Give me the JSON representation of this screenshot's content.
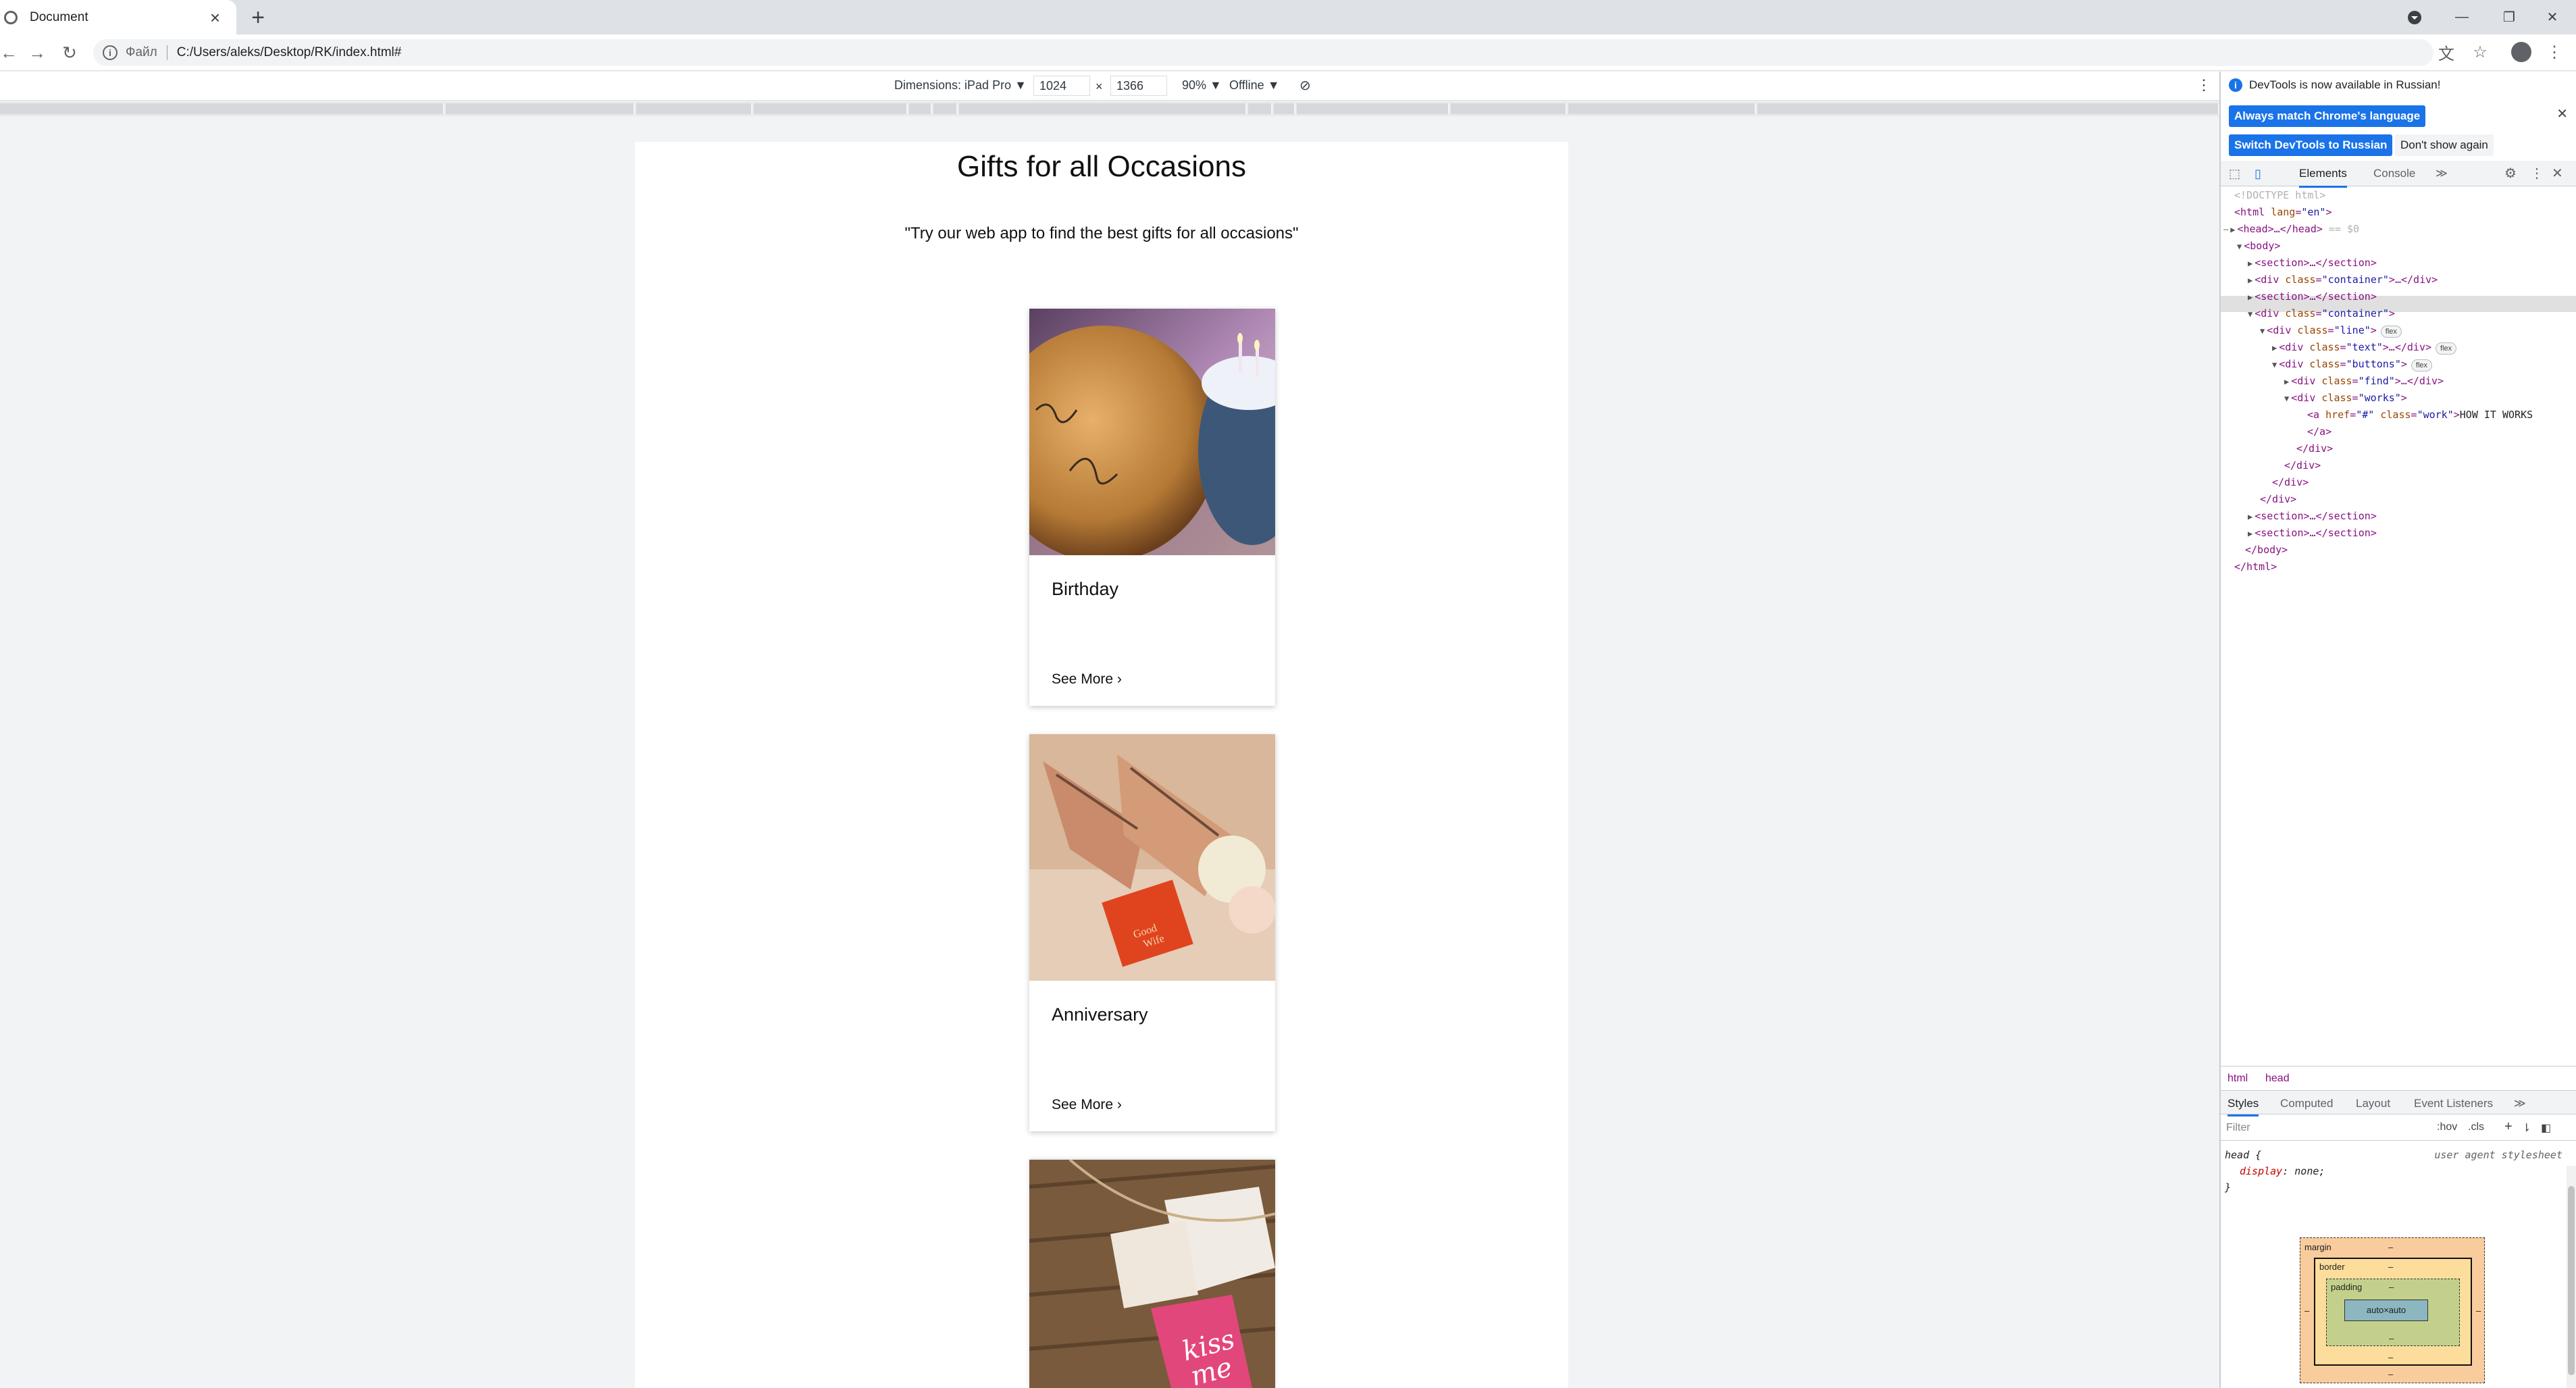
{
  "browser": {
    "tab_title": "Document",
    "url_scheme": "Файл",
    "url": "C:/Users/aleks/Desktop/RK/index.html#"
  },
  "device_toolbar": {
    "dimensions_label": "Dimensions: iPad Pro ▼",
    "width": "1024",
    "times": "×",
    "height": "1366",
    "zoom": "90% ▼",
    "throttle": "Offline ▼"
  },
  "page": {
    "title": "Gifts for all Occasions",
    "subtitle": "\"Try our web app to find the best gifts for all occasions\"",
    "cards": [
      {
        "name": "Birthday",
        "link": "See More ›"
      },
      {
        "name": "Anniversary",
        "link": "See More ›"
      }
    ]
  },
  "devtools": {
    "banner_text": "DevTools is now available in Russian!",
    "btn_match": "Always match Chrome's language",
    "btn_switch": "Switch DevTools to Russian",
    "btn_dont": "Don't show again",
    "tab_elements": "Elements",
    "tab_console": "Console",
    "tab_more": "≫",
    "dom": {
      "l0": "<!DOCTYPE html>",
      "l1_tag": "<html ",
      "l1_attr": "lang",
      "l1_val": "\"en\"",
      "l1_end": ">",
      "l2": "<head>…</head>",
      "l2_eq": " == $0",
      "l3": "<body>",
      "l4": "<section>…</section>",
      "l5_tag": "<div ",
      "l5_attr": "class",
      "l5_val": "\"container\"",
      "l5_end": ">…</div>",
      "l6": "<section>…</section>",
      "l7_val": "\"container\"",
      "l8_val": "\"line\"",
      "flex": "flex",
      "l9_val": "\"text\"",
      "l9_end": ">…</div>",
      "l10_val": "\"buttons\"",
      "l11_val": "\"find\"",
      "l12_val": "\"works\"",
      "l13_tag": "<a ",
      "l13_attr1": "href",
      "l13_val1": "\"#\"",
      "l13_attr2": "class",
      "l13_val2": "\"work\"",
      "l13_text": "HOW IT WORKS",
      "l14": "</a>",
      "close_div": "</div>",
      "l20": "<section>…</section>",
      "l21": "<section>…</section>",
      "l22": "</body>",
      "l23": "</html>"
    },
    "crumb_html": "html",
    "crumb_head": "head",
    "styles_tabs": [
      "Styles",
      "Computed",
      "Layout",
      "Event Listeners",
      "≫"
    ],
    "filter_placeholder": "Filter",
    "hov": ":hov",
    "cls": ".cls",
    "rule_selector": "head {",
    "rule_source": "user agent stylesheet",
    "rule_prop": "display",
    "rule_val": "none;",
    "rule_close": "}",
    "box": {
      "margin": "margin",
      "border": "border",
      "padding": "padding",
      "content": "auto×auto",
      "dash": "–"
    }
  }
}
